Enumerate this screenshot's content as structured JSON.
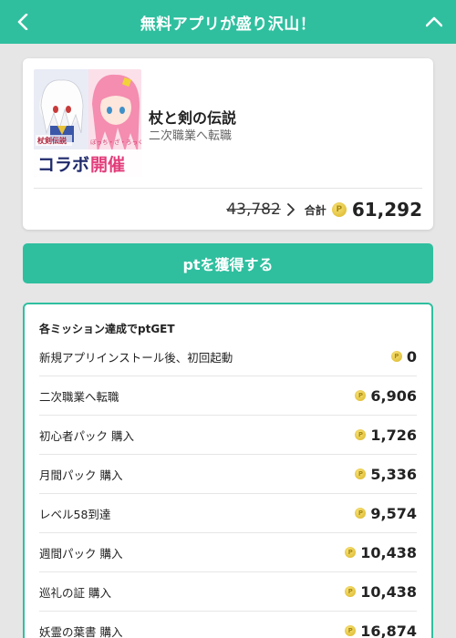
{
  "header": {
    "title": "無料アプリが盛り沢山！",
    "back_icon": "chevron-left-icon",
    "collapse_icon": "chevron-up-icon",
    "color": "#2fbf9f"
  },
  "game": {
    "name": "杖と剣の伝説",
    "subtitle": "二次職業へ転職",
    "banner": {
      "logo_text": "杖剣伝説",
      "collab_text": "ぼっち・ざ・ろっく",
      "headline_left": "コラボ",
      "headline_right": "開催"
    },
    "old_total": "43,782",
    "total_label": "合計",
    "total": "61,292"
  },
  "cta": {
    "label": "ptを獲得する"
  },
  "missions": {
    "heading": "各ミッション達成でptGET",
    "items": [
      {
        "label": "新規アプリインストール後、初回起動",
        "points": "0"
      },
      {
        "label": "二次職業へ転職",
        "points": "6,906"
      },
      {
        "label": "初心者パック 購入",
        "points": "1,726"
      },
      {
        "label": "月間パック 購入",
        "points": "5,336"
      },
      {
        "label": "レベル58到達",
        "points": "9,574"
      },
      {
        "label": "週間パック 購入",
        "points": "10,438"
      },
      {
        "label": "巡礼の証 購入",
        "points": "10,438"
      },
      {
        "label": "妖霊の葉書 購入",
        "points": "16,874"
      }
    ]
  }
}
